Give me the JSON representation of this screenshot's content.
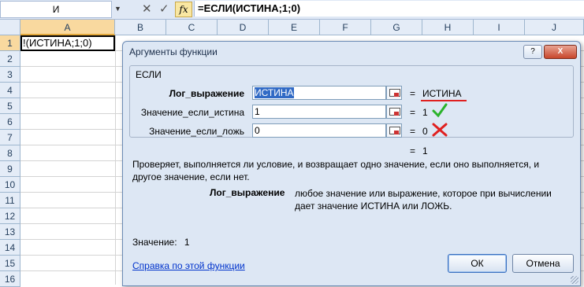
{
  "formula_bar": {
    "name_box": "И",
    "cancel_icon": "✕",
    "enter_icon": "✓",
    "fx_label": "fx",
    "formula": "=ЕСЛИ(ИСТИНА;1;0)"
  },
  "sheet": {
    "columns": [
      "A",
      "B",
      "C",
      "D",
      "E",
      "F",
      "G",
      "H",
      "I",
      "J"
    ],
    "rows": [
      "1",
      "2",
      "3",
      "4",
      "5",
      "6",
      "7",
      "8",
      "9",
      "10",
      "11",
      "12",
      "13",
      "14",
      "15",
      "16"
    ],
    "active_cell_text": "!(ИСТИНА;1;0)"
  },
  "dialog": {
    "title": "Аргументы функции",
    "help_button": "?",
    "close_button": "X",
    "function_name": "ЕСЛИ",
    "args": [
      {
        "label": "Лог_выражение",
        "value": "ИСТИНА",
        "result": "ИСТИНА"
      },
      {
        "label": "Значение_если_истина",
        "value": "1",
        "result": "1"
      },
      {
        "label": "Значение_если_ложь",
        "value": "0",
        "result": "0"
      }
    ],
    "formula_result": "1",
    "description": "Проверяет, выполняется ли условие, и возвращает одно значение, если оно выполняется, и другое значение, если нет.",
    "arg_help_name": "Лог_выражение",
    "arg_help_text": "любое значение или выражение, которое при вычислении дает значение ИСТИНА или ЛОЖЬ.",
    "value_label": "Значение:",
    "value": "1",
    "help_link": "Справка по этой функции",
    "ok_label": "ОК",
    "cancel_label": "Отмена"
  },
  "annotations": {
    "underline_color": "#e02020",
    "check_color": "#2bb32b",
    "cross_color": "#e02020"
  }
}
